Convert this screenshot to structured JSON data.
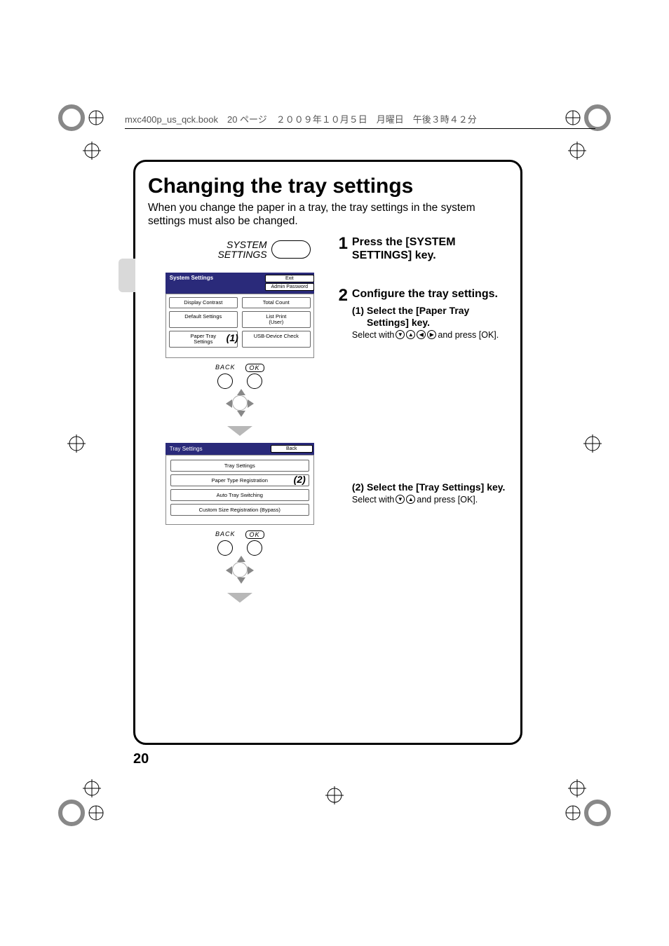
{
  "header_text": "mxc400p_us_qck.book　20 ページ　２００９年１０月５日　月曜日　午後３時４２分",
  "title": "Changing the tray settings",
  "intro": "When you change the paper in a tray, the tray settings in the system settings must also be changed.",
  "system_key_label_l1": "SYSTEM",
  "system_key_label_l2": "SETTINGS",
  "lcd1": {
    "title": "System Settings",
    "exit": "Exit",
    "admin": "Admin Password",
    "btns": {
      "display_contrast": "Display Contrast",
      "total_count": "Total Count",
      "default_settings": "Default Settings",
      "list_print_l1": "List Print",
      "list_print_l2": "(User)",
      "paper_tray_l1": "Paper Tray",
      "paper_tray_l2": "Settings",
      "usb": "USB-Device Check"
    },
    "marker": "(1)"
  },
  "pad": {
    "back": "BACK",
    "ok": "OK"
  },
  "lcd2": {
    "title": "Tray Settings",
    "back": "Back",
    "rows": {
      "tray_settings": "Tray Settings",
      "paper_type_reg": "Paper Type Registration",
      "auto_switch": "Auto Tray Switching",
      "custom_size": "Custom Size Registration (Bypass)"
    },
    "marker": "(2)"
  },
  "steps": {
    "s1": {
      "num": "1",
      "title": "Press the [SYSTEM SETTINGS] key."
    },
    "s2": {
      "num": "2",
      "title": "Configure the tray settings.",
      "sub1": {
        "num": "(1)",
        "title": "Select the [Paper Tray Settings] key.",
        "text_a": "Select with ",
        "text_b": " and press [OK]."
      },
      "sub2": {
        "num": "(2)",
        "title": "Select the [Tray Settings] key.",
        "text_a": "Select with ",
        "text_b": " and press [OK]."
      }
    }
  },
  "page_number": "20"
}
